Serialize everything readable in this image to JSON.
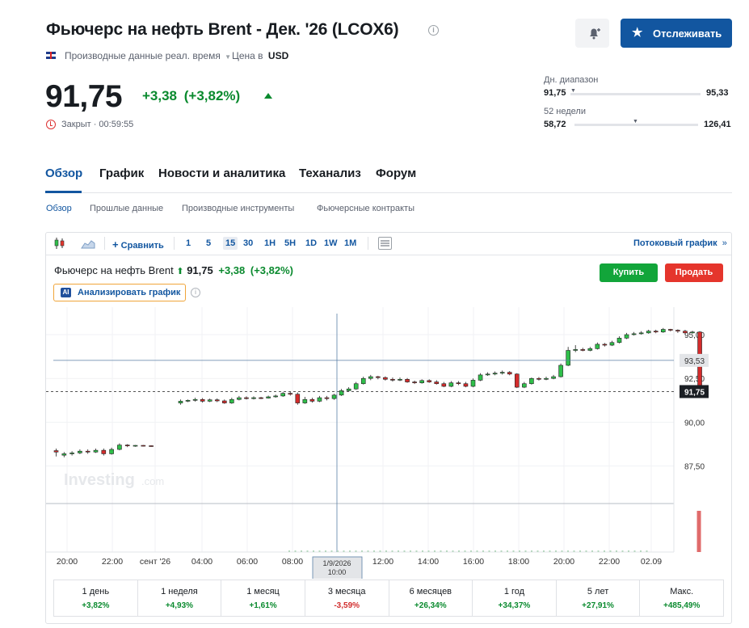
{
  "header": {
    "title": "Фьючерс на нефть Brent - Дек. '26 (LCOX6)",
    "data_type": "Производные данные реал. время",
    "price_in": "Цена в",
    "currency": "USD",
    "follow_label": "Отслеживать"
  },
  "quote": {
    "price": "91,75",
    "change": "+3,38",
    "change_pct": "(+3,82%)",
    "status": "Закрыт · 00:59:55"
  },
  "ranges": {
    "day_label": "Дн. диапазон",
    "day_low": "91,75",
    "day_high": "95,33",
    "day_position": 0.0,
    "week52_label": "52 недели",
    "week52_low": "58,72",
    "week52_high": "126,41",
    "week52_position": 0.49
  },
  "main_nav": [
    "Обзор",
    "График",
    "Новости и аналитика",
    "Теханализ",
    "Форум"
  ],
  "sub_nav": [
    "Обзор",
    "Прошлые данные",
    "Производные инструменты",
    "Фьючерсные контракты"
  ],
  "toolbar": {
    "compare": "Сравнить",
    "intervals": [
      "1",
      "5",
      "15",
      "30",
      "1H",
      "5H",
      "1D",
      "1W",
      "1M"
    ],
    "selected_interval": "15",
    "stream": "Потоковый график"
  },
  "instrument": {
    "name": "Фьючерс на нефть Brent",
    "price": "91,75",
    "change": "+3,38",
    "change_pct": "(+3,82%)",
    "buy": "Купить",
    "sell": "Продать",
    "ai_label": "Анализировать график"
  },
  "chart_data": {
    "type": "candlestick",
    "y_ticks": [
      "95,00",
      "92,50",
      "90,00",
      "87,50"
    ],
    "x_ticks": [
      "20:00",
      "22:00",
      "сент '26",
      "04:00",
      "06:00",
      "08:00",
      "12:00",
      "14:00",
      "16:00",
      "18:00",
      "20:00",
      "22:00",
      "02.09"
    ],
    "crosshair_x_label": "1/9/2026\n10:00",
    "crosshair_y_label": "93,53",
    "last_price_label": "91,75",
    "ylim": [
      85.5,
      96.2
    ],
    "candles": [
      [
        88.38,
        88.3,
        88.5,
        88.05
      ],
      [
        88.12,
        88.2,
        88.3,
        88.0
      ],
      [
        88.2,
        88.25,
        88.35,
        88.1
      ],
      [
        88.25,
        88.35,
        88.45,
        88.18
      ],
      [
        88.35,
        88.3,
        88.45,
        88.2
      ],
      [
        88.3,
        88.4,
        88.5,
        88.25
      ],
      [
        88.4,
        88.2,
        88.5,
        88.1
      ],
      [
        88.2,
        88.45,
        88.55,
        88.15
      ],
      [
        88.45,
        88.7,
        88.8,
        88.4
      ],
      [
        88.7,
        88.65,
        88.75,
        88.58
      ],
      [
        88.65,
        88.68,
        88.7,
        88.6
      ],
      [
        88.68,
        88.66,
        88.7,
        88.62
      ],
      [
        88.66,
        88.65,
        88.68,
        88.6
      ],
      [
        91.1,
        91.2,
        91.3,
        91.0
      ],
      [
        91.2,
        91.25,
        91.3,
        91.15
      ],
      [
        91.25,
        91.3,
        91.4,
        91.18
      ],
      [
        91.3,
        91.2,
        91.38,
        91.12
      ],
      [
        91.2,
        91.28,
        91.35,
        91.15
      ],
      [
        91.28,
        91.22,
        91.36,
        91.15
      ],
      [
        91.22,
        91.1,
        91.3,
        91.05
      ],
      [
        91.1,
        91.3,
        91.4,
        91.05
      ],
      [
        91.3,
        91.4,
        91.5,
        91.25
      ],
      [
        91.4,
        91.35,
        91.48,
        91.3
      ],
      [
        91.35,
        91.4,
        91.48,
        91.3
      ],
      [
        91.4,
        91.38,
        91.45,
        91.32
      ],
      [
        91.38,
        91.45,
        91.52,
        91.35
      ],
      [
        91.45,
        91.5,
        91.58,
        91.4
      ],
      [
        91.5,
        91.65,
        91.72,
        91.45
      ],
      [
        91.65,
        91.6,
        91.75,
        91.52
      ],
      [
        91.6,
        91.1,
        91.7,
        91.0
      ],
      [
        91.1,
        91.3,
        91.45,
        91.05
      ],
      [
        91.3,
        91.2,
        91.4,
        91.12
      ],
      [
        91.2,
        91.4,
        91.5,
        91.15
      ],
      [
        91.4,
        91.35,
        91.5,
        91.25
      ],
      [
        91.35,
        91.55,
        91.62,
        91.28
      ],
      [
        91.55,
        91.8,
        91.9,
        91.5
      ],
      [
        91.8,
        91.9,
        92.0,
        91.75
      ],
      [
        91.9,
        92.2,
        92.3,
        91.85
      ],
      [
        92.2,
        92.5,
        92.6,
        92.15
      ],
      [
        92.5,
        92.6,
        92.7,
        92.4
      ],
      [
        92.6,
        92.55,
        92.65,
        92.45
      ],
      [
        92.55,
        92.45,
        92.62,
        92.38
      ],
      [
        92.45,
        92.4,
        92.55,
        92.32
      ],
      [
        92.4,
        92.45,
        92.55,
        92.35
      ],
      [
        92.45,
        92.3,
        92.52,
        92.25
      ],
      [
        92.3,
        92.25,
        92.38,
        92.18
      ],
      [
        92.25,
        92.38,
        92.45,
        92.2
      ],
      [
        92.38,
        92.3,
        92.45,
        92.25
      ],
      [
        92.3,
        92.2,
        92.4,
        92.15
      ],
      [
        92.2,
        92.05,
        92.3,
        92.0
      ],
      [
        92.05,
        92.25,
        92.35,
        92.0
      ],
      [
        92.25,
        92.2,
        92.35,
        92.12
      ],
      [
        92.2,
        92.05,
        92.3,
        92.0
      ],
      [
        92.05,
        92.4,
        92.5,
        92.0
      ],
      [
        92.4,
        92.7,
        92.8,
        92.35
      ],
      [
        92.7,
        92.75,
        92.85,
        92.65
      ],
      [
        92.75,
        92.8,
        92.9,
        92.68
      ],
      [
        92.8,
        92.85,
        92.95,
        92.72
      ],
      [
        92.85,
        92.75,
        92.92,
        92.68
      ],
      [
        92.75,
        92.0,
        92.8,
        91.95
      ],
      [
        92.0,
        92.2,
        92.3,
        91.95
      ],
      [
        92.2,
        92.5,
        92.55,
        92.15
      ],
      [
        92.5,
        92.45,
        92.58,
        92.38
      ],
      [
        92.45,
        92.5,
        92.6,
        92.4
      ],
      [
        92.5,
        92.6,
        92.7,
        92.45
      ],
      [
        92.6,
        93.25,
        93.35,
        92.55
      ],
      [
        93.25,
        94.1,
        94.3,
        93.2
      ],
      [
        94.1,
        94.15,
        94.4,
        94.0
      ],
      [
        94.15,
        94.1,
        94.25,
        94.05
      ],
      [
        94.1,
        94.2,
        94.3,
        94.05
      ],
      [
        94.2,
        94.45,
        94.55,
        94.15
      ],
      [
        94.45,
        94.4,
        94.52,
        94.32
      ],
      [
        94.4,
        94.55,
        94.65,
        94.35
      ],
      [
        94.55,
        94.8,
        94.9,
        94.5
      ],
      [
        94.8,
        95.0,
        95.1,
        94.75
      ],
      [
        95.0,
        95.05,
        95.15,
        94.95
      ],
      [
        95.05,
        95.1,
        95.2,
        95.0
      ],
      [
        95.1,
        95.2,
        95.28,
        95.05
      ],
      [
        95.2,
        95.15,
        95.28,
        95.08
      ],
      [
        95.15,
        95.3,
        95.38,
        95.1
      ],
      [
        95.3,
        95.25,
        95.33,
        95.18
      ],
      [
        95.25,
        95.2,
        95.3,
        95.1
      ],
      [
        95.2,
        95.1,
        95.28,
        95.0
      ],
      [
        95.1,
        95.15,
        95.22,
        95.05
      ],
      [
        95.15,
        91.75,
        95.2,
        91.7
      ]
    ],
    "volume_x_index": 84,
    "volume_value_rel": 1.0
  },
  "performance": [
    {
      "period": "1 день",
      "value": "+3,82%",
      "dir": "pos"
    },
    {
      "period": "1 неделя",
      "value": "+4,93%",
      "dir": "pos"
    },
    {
      "period": "1 месяц",
      "value": "+1,61%",
      "dir": "pos"
    },
    {
      "period": "3 месяца",
      "value": "-3,59%",
      "dir": "neg"
    },
    {
      "period": "6 месяцев",
      "value": "+26,34%",
      "dir": "pos"
    },
    {
      "period": "1 год",
      "value": "+34,37%",
      "dir": "pos"
    },
    {
      "period": "5 лет",
      "value": "+27,91%",
      "dir": "pos"
    },
    {
      "period": "Макс.",
      "value": "+485,49%",
      "dir": "pos"
    }
  ]
}
